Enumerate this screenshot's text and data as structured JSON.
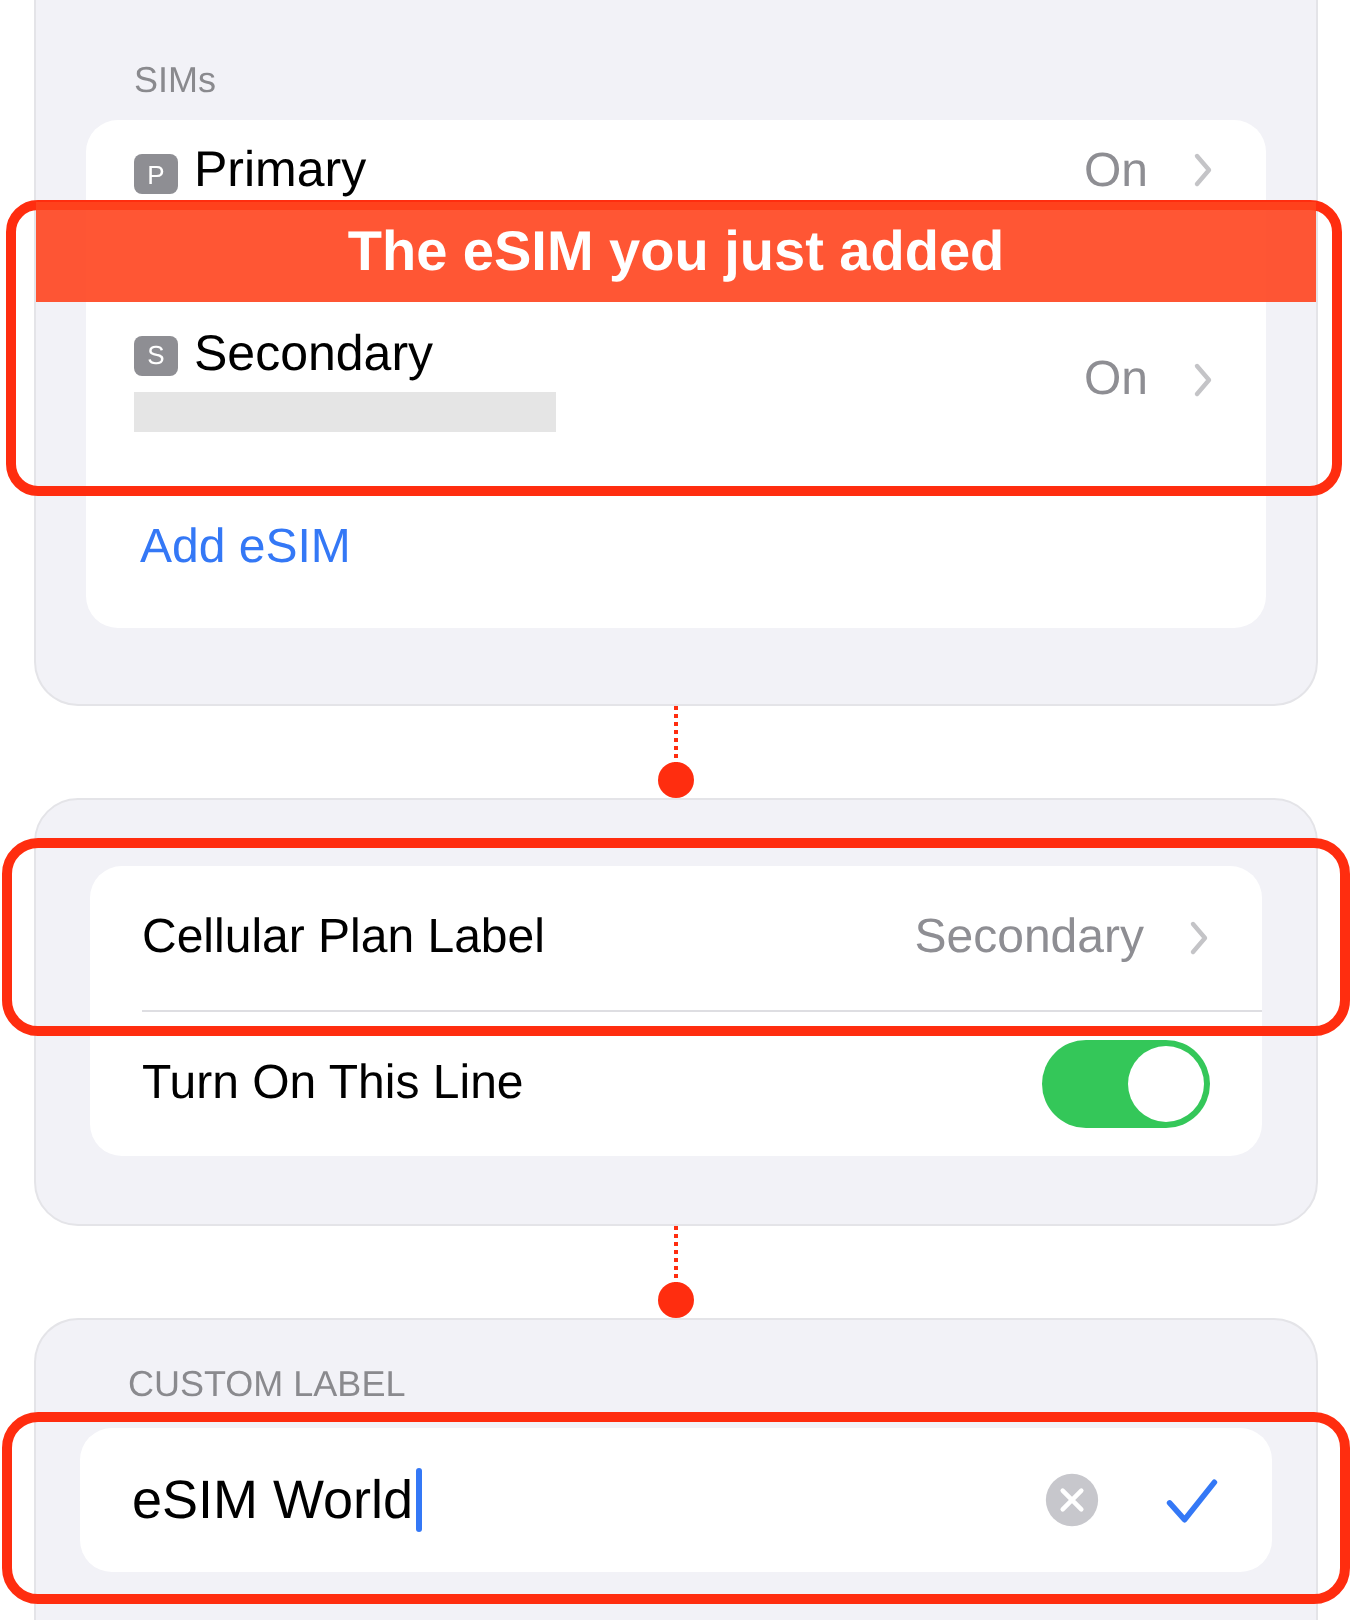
{
  "sims_section": {
    "header": "SIMs",
    "sims": [
      {
        "badge": "P",
        "name": "Primary",
        "status": "On"
      },
      {
        "badge": "S",
        "name": "Secondary",
        "status": "On"
      }
    ],
    "add_link": "Add eSIM"
  },
  "annotation": {
    "banner": "The eSIM you just added"
  },
  "plan_section": {
    "rows": [
      {
        "kind": "link",
        "label": "Cellular Plan Label",
        "value": "Secondary"
      },
      {
        "kind": "toggle",
        "label": "Turn On This Line",
        "on": true
      }
    ]
  },
  "custom_label": {
    "header": "CUSTOM LABEL",
    "value": "eSIM World"
  }
}
